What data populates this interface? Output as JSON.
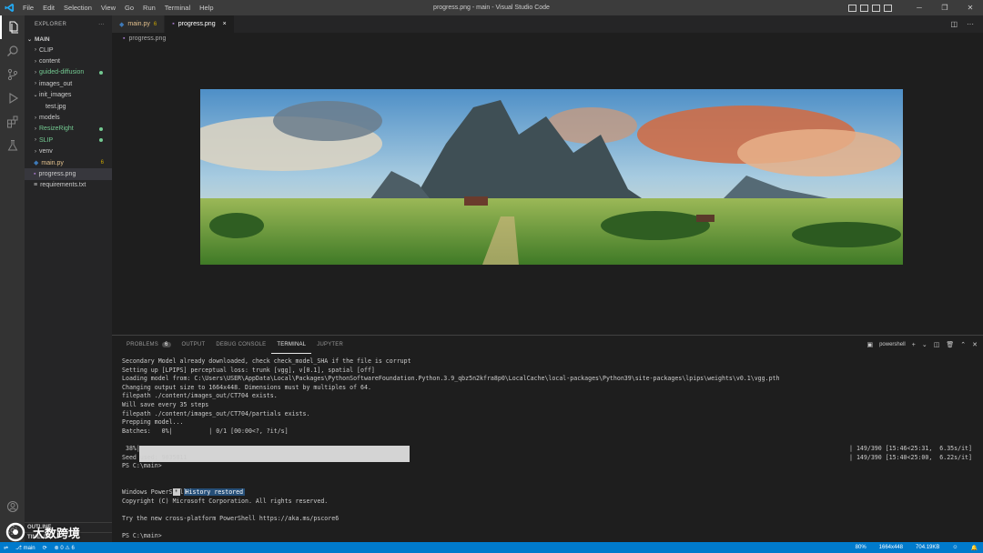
{
  "window": {
    "title": "progress.png - main - Visual Studio Code",
    "menu": [
      "File",
      "Edit",
      "Selection",
      "View",
      "Go",
      "Run",
      "Terminal",
      "Help"
    ]
  },
  "sidebar": {
    "header": "EXPLORER",
    "more": "···",
    "section": "MAIN",
    "items": [
      {
        "label": "CLIP",
        "type": "folder"
      },
      {
        "label": "content",
        "type": "folder"
      },
      {
        "label": "guided-diffusion",
        "type": "folder",
        "status": "modified"
      },
      {
        "label": "images_out",
        "type": "folder"
      },
      {
        "label": "init_images",
        "type": "folder-open"
      },
      {
        "label": "test.jpg",
        "type": "file"
      },
      {
        "label": "models",
        "type": "folder"
      },
      {
        "label": "ResizeRight",
        "type": "folder",
        "status": "modified"
      },
      {
        "label": "SLIP",
        "type": "folder",
        "status": "modified"
      },
      {
        "label": "venv",
        "type": "folder"
      },
      {
        "label": "main.py",
        "type": "file",
        "badge": "6"
      },
      {
        "label": "progress.png",
        "type": "file",
        "selected": true
      },
      {
        "label": "requirements.txt",
        "type": "file"
      }
    ],
    "outline": "OUTLINE",
    "timeline": "TIMELINE"
  },
  "editor": {
    "tabs": [
      {
        "label": "main.py",
        "badge": "6",
        "active": false
      },
      {
        "label": "progress.png",
        "close": "×",
        "active": true
      }
    ],
    "breadcrumb": "progress.png"
  },
  "panel": {
    "tabs": [
      {
        "label": "PROBLEMS",
        "count": "6"
      },
      {
        "label": "OUTPUT"
      },
      {
        "label": "DEBUG CONSOLE"
      },
      {
        "label": "TERMINAL",
        "active": true
      },
      {
        "label": "JUPYTER"
      }
    ],
    "shell": "powershell",
    "terminal": {
      "lines_top": [
        "Secondary Model already downloaded, check check_model_SHA if the file is corrupt",
        "Setting up [LPIPS] perceptual loss: trunk [vgg], v[0.1], spatial [off]",
        "Loading model from: C:\\Users\\USER\\AppData\\Local\\Packages\\PythonSoftwareFoundation.Python.3.9_qbz5n2kfra8p0\\LocalCache\\local-packages\\Python39\\site-packages\\lpips\\weights\\v0.1\\vgg.pth",
        "Changing output size to 1664x448. Dimensions must by multiples of 64.",
        "filepath ./content/images_out/CT704 exists.",
        "Will save every 35 steps",
        "filepath ./content/images_out/CT704/partials exists.",
        "Prepping model...",
        "Batches:   0%|          | 0/1 [00:00<?, ?it/s]"
      ],
      "progress_pct": " 38%|",
      "progress_right_1": "| 149/390 [15:46<25:31,  6.35s/it]",
      "seed_line": "Seed used: 9035811",
      "progress_right_2": "| 149/390 [15:40<25:00,  6.22s/it]",
      "prompt1": "PS C:\\main>",
      "history_x": "*",
      "history_text": "History restored",
      "lines_bottom": [
        "",
        "Windows PowerShell",
        "Copyright (C) Microsoft Corporation. All rights reserved.",
        "",
        "Try the new cross-platform PowerShell https://aka.ms/pscore6",
        "",
        "PS C:\\main>"
      ]
    }
  },
  "statusbar": {
    "branch": "main",
    "errors": "0",
    "warnings": "6",
    "zoom": "80%",
    "dimensions": "1664x448",
    "filesize": "704.19KB"
  },
  "watermark": {
    "text": "大数跨境"
  },
  "colors": {
    "accent": "#007acc",
    "activity": "#333333",
    "sidebar": "#252526",
    "editor": "#1e1e1e"
  }
}
